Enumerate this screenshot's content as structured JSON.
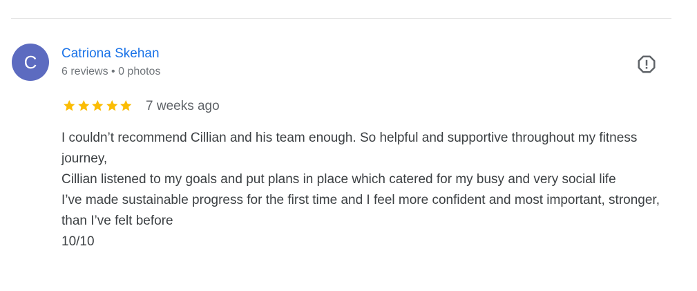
{
  "reviewer": {
    "initial": "C",
    "avatar_color": "#5c6bc0",
    "name": "Catriona Skehan",
    "meta": "6 reviews • 0 photos"
  },
  "review": {
    "rating": 5,
    "max_rating": 5,
    "star_color": "#fbbc04",
    "time_ago": "7 weeks ago",
    "paragraphs": [
      "I couldn’t recommend Cillian and his team enough. So helpful and supportive throughout my fitness journey,",
      "Cillian listened to my goals and put plans in place which catered for my busy and very social life",
      "I’ve made sustainable progress for the first time and I feel more confident and most important, stronger, than I’ve felt before",
      "10/10"
    ]
  },
  "actions": {
    "report_icon": "report-flag-octagon-icon"
  }
}
